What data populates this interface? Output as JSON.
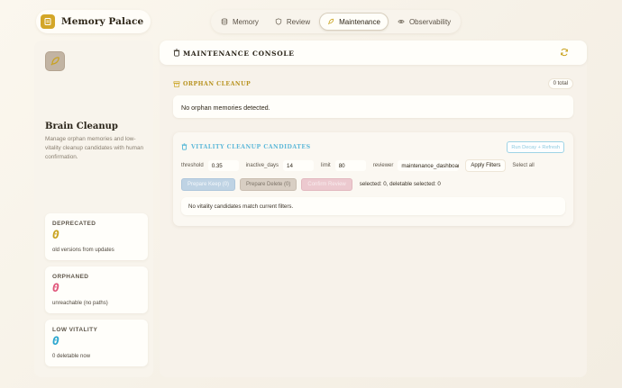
{
  "brand": {
    "title": "Memory Palace"
  },
  "nav": {
    "tabs": [
      {
        "label": "Memory",
        "icon": "database-icon",
        "active": false
      },
      {
        "label": "Review",
        "icon": "shield-icon",
        "active": false
      },
      {
        "label": "Maintenance",
        "icon": "feather-icon",
        "active": true
      },
      {
        "label": "Observability",
        "icon": "eye-icon",
        "active": false
      }
    ]
  },
  "sidebar": {
    "title": "Brain Cleanup",
    "description": "Manage orphan memories and low-vitality cleanup candidates with human confirmation.",
    "stats": [
      {
        "label": "DEPRECATED",
        "value": "0",
        "note": "old versions from updates",
        "color": "#c9a21e"
      },
      {
        "label": "ORPHANED",
        "value": "0",
        "note": "unreachable (no paths)",
        "color": "#e0557a"
      },
      {
        "label": "LOW VITALITY",
        "value": "0",
        "note": "0 deletable now",
        "color": "#2aa6cf"
      }
    ]
  },
  "console": {
    "title": "MAINTENANCE CONSOLE"
  },
  "orphan": {
    "label": "ORPHAN CLEANUP",
    "count": "0 total",
    "empty": "No orphan memories detected."
  },
  "vitality": {
    "label": "VITALITY CLEANUP CANDIDATES",
    "run_button": "Run Decay + Refresh",
    "filters": {
      "threshold_label": "threshold",
      "threshold_value": "0.35",
      "inactive_label": "inactive_days",
      "inactive_value": "14",
      "limit_label": "limit",
      "limit_value": "80",
      "reviewer_label": "reviewer",
      "reviewer_value": "maintenance_dashboard"
    },
    "apply_button": "Apply Filters",
    "select_all": "Select all",
    "prepare_keep": "Prepare Keep (0)",
    "prepare_delete": "Prepare Delete (0)",
    "confirm_review": "Confirm Review",
    "selection_status": "selected: 0, deletable selected: 0",
    "empty": "No vitality candidates match current filters."
  },
  "colors": {
    "accent_gold": "#d3a628",
    "accent_cyan": "#2aa6cf",
    "accent_pink": "#e0557a"
  }
}
